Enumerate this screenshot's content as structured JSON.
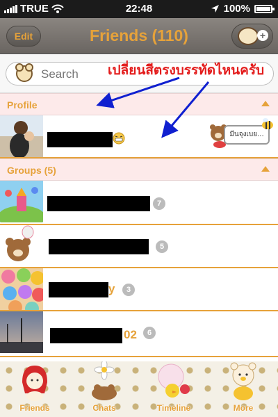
{
  "status_bar": {
    "carrier": "TRUE",
    "time": "22:48",
    "battery": "100%"
  },
  "nav": {
    "edit_label": "Edit",
    "title": "Friends (110)"
  },
  "search": {
    "placeholder": "Search"
  },
  "annotation": {
    "text": "เปลี่ยนสีตรงบรรทัดไหนครับ",
    "color": "#e31b1b"
  },
  "profile_section": {
    "label": "Profile",
    "status_message": "มีนจุงเบย..."
  },
  "groups_section": {
    "label": "Groups (5)"
  },
  "groups": [
    {
      "count": "7",
      "visible_suffix": ""
    },
    {
      "count": "5",
      "visible_suffix": ""
    },
    {
      "count": "3",
      "visible_suffix": "y"
    },
    {
      "count": "6",
      "visible_suffix": "02"
    }
  ],
  "tabs": [
    {
      "label": "Friends"
    },
    {
      "label": "Chats"
    },
    {
      "label": "Timeline"
    },
    {
      "label": "More"
    }
  ],
  "colors": {
    "accent": "#e6a23a",
    "section_bg": "#fdeaea",
    "nav_bg": "#7a7570",
    "arrow": "#1020d0"
  }
}
